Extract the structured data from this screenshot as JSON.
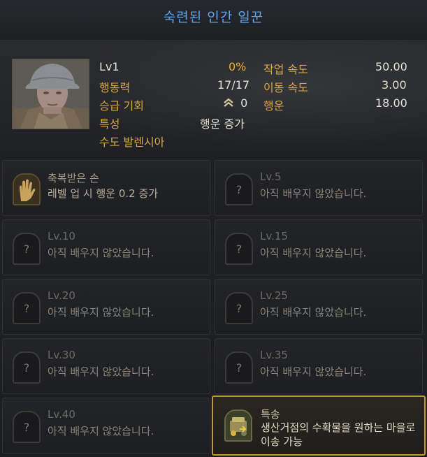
{
  "window": {
    "title": "숙련된 인간 일꾼"
  },
  "worker": {
    "level": "Lv1",
    "exp_percent": "0%",
    "stamina_label": "행동력",
    "stamina_value": "17/17",
    "promotion_label": "승급 기회",
    "promotion_value": "0",
    "trait_label": "특성",
    "trait_value": "행운 증가",
    "location": "수도 발렌시아",
    "work_speed_label": "작업 속도",
    "work_speed_value": "50.00",
    "move_speed_label": "이동 속도",
    "move_speed_value": "3.00",
    "luck_label": "행운",
    "luck_value": "18.00"
  },
  "skills": [
    {
      "title": "축복받은 손",
      "desc": "레벨 업 시 행운 0.2 증가",
      "icon": "blessed-hand-icon"
    },
    {
      "title": "Lv.5",
      "desc": "아직 배우지 않았습니다.",
      "icon": "locked-skill-icon"
    },
    {
      "title": "Lv.10",
      "desc": "아직 배우지 않았습니다.",
      "icon": "locked-skill-icon"
    },
    {
      "title": "Lv.15",
      "desc": "아직 배우지 않았습니다.",
      "icon": "locked-skill-icon"
    },
    {
      "title": "Lv.20",
      "desc": "아직 배우지 않았습니다.",
      "icon": "locked-skill-icon"
    },
    {
      "title": "Lv.25",
      "desc": "아직 배우지 않았습니다.",
      "icon": "locked-skill-icon"
    },
    {
      "title": "Lv.30",
      "desc": "아직 배우지 않았습니다.",
      "icon": "locked-skill-icon"
    },
    {
      "title": "Lv.35",
      "desc": "아직 배우지 않았습니다.",
      "icon": "locked-skill-icon"
    },
    {
      "title": "Lv.40",
      "desc": "아직 배우지 않았습니다.",
      "icon": "locked-skill-icon"
    },
    {
      "title": "특송",
      "desc": "생산거점의 수확물을 원하는 마을로 이송 가능",
      "icon": "express-delivery-icon"
    }
  ],
  "colors": {
    "title": "#5ea6f2",
    "label": "#d9a644",
    "highlight_border": "#c9952f",
    "percent": "#f0b030"
  }
}
